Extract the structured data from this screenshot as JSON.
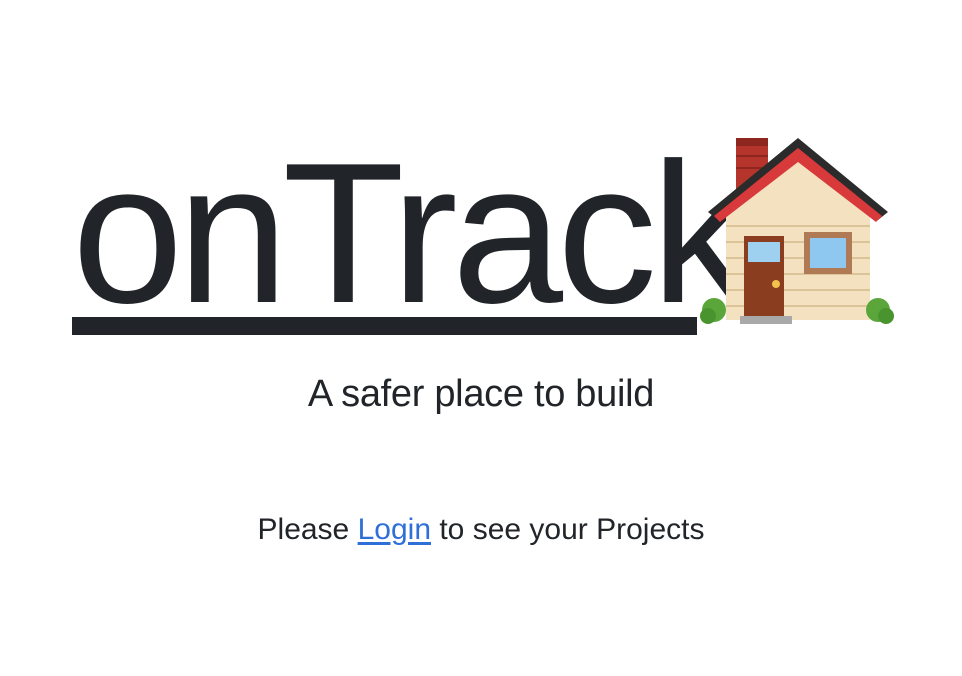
{
  "header": {
    "brand": "onTrack",
    "house_icon": "house-emoji-icon",
    "tagline": "A safer place to build"
  },
  "login_prompt": {
    "prefix": "Please ",
    "link_label": "Login",
    "suffix": " to see your Projects"
  },
  "colors": {
    "text": "#212529",
    "link": "#2f6fd8",
    "background": "#ffffff"
  }
}
